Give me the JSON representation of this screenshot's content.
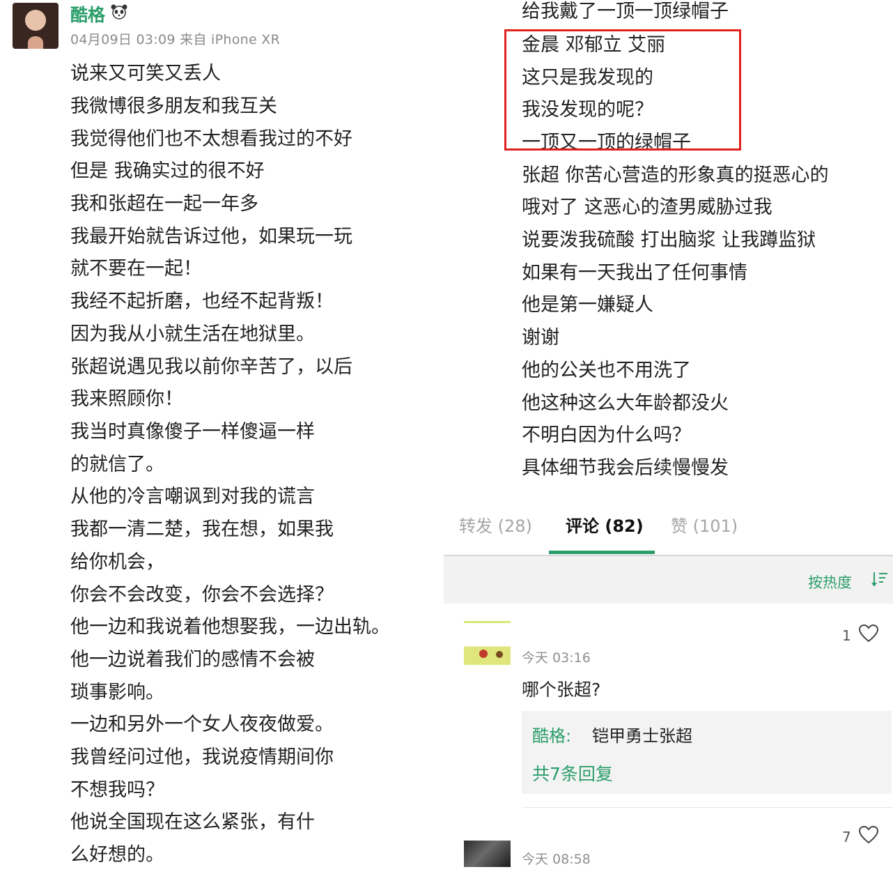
{
  "post": {
    "username": "酷格",
    "badge_icon": "panda-icon",
    "timestamp": "04月09日 03:09",
    "source": "来自 iPhone XR",
    "left_lines": [
      "说来又可笑又丢人",
      "我微博很多朋友和我互关",
      "我觉得他们也不太想看我过的不好",
      "但是 我确实过的很不好",
      "我和张超在一起一年多",
      "我最开始就告诉过他，如果玩一玩",
      "就不要在一起！",
      "我经不起折磨，也经不起背叛！",
      "因为我从小就生活在地狱里。",
      "张超说遇见我以前你辛苦了，以后",
      "我来照顾你！",
      "我当时真像傻子一样傻逼一样",
      "的就信了。",
      "从他的冷言嘲讽到对我的谎言",
      "我都一清二楚，我在想，如果我",
      "给你机会，",
      "你会不会改变，你会不会选择？",
      "他一边和我说着他想娶我，一边出轨。",
      "他一边说着我们的感情不会被",
      "琐事影响。",
      "一边和另外一个女人夜夜做爱。",
      "我曾经问过他，我说疫情期间你",
      "不想我吗？",
      "他说全国现在这么紧张，有什",
      "么好想的。"
    ],
    "right_lines": [
      "给我戴了一顶一顶绿帽子",
      "金晨 邓郁立 艾丽",
      "这只是我发现的",
      "我没发现的呢？",
      "一顶又一顶的绿帽子",
      "张超 你苦心营造的形象真的挺恶心的",
      "哦对了 这恶心的渣男威胁过我",
      "说要泼我硫酸 打出脑浆 让我蹲监狱",
      "如果有一天我出了任何事情",
      "他是第一嫌疑人",
      "谢谢",
      "他的公关也不用洗了",
      "他这种这么大年龄都没火",
      "不明白因为什么吗？",
      "具体细节我会后续慢慢发"
    ]
  },
  "tabs": {
    "repost": "转发 (28)",
    "comment": "评论 (82)",
    "like": "赞 (101)"
  },
  "sort": {
    "label": "按热度",
    "icon": "sort-icon"
  },
  "comments": [
    {
      "time": "今天 03:16",
      "likes": "1",
      "text": "哪个张超?",
      "reply": {
        "author": "酷格:",
        "text": "铠甲勇士张超",
        "more": "共7条回复"
      }
    },
    {
      "time": "今天 08:58",
      "likes": "7"
    }
  ],
  "colors": {
    "accent": "#2b9e6a",
    "highlight": "#e0201c"
  }
}
